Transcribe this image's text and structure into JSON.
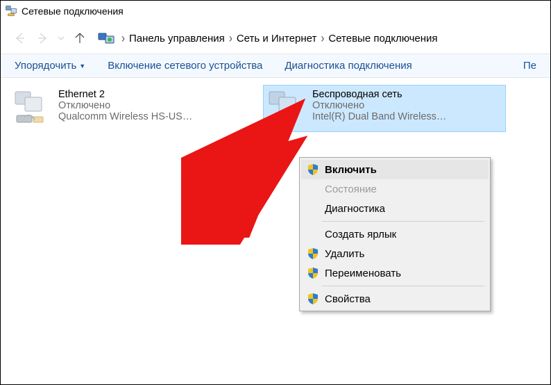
{
  "window": {
    "title": "Сетевые подключения"
  },
  "breadcrumb": {
    "items": [
      "Панель управления",
      "Сеть и Интернет",
      "Сетевые подключения"
    ]
  },
  "toolbar": {
    "organize": "Упорядочить",
    "enable_device": "Включение сетевого устройства",
    "diagnose": "Диагностика подключения",
    "more": "Пе"
  },
  "adapters": [
    {
      "name": "Ethernet 2",
      "status": "Отключено",
      "device": "Qualcomm Wireless HS-US…",
      "selected": false
    },
    {
      "name": "Беспроводная сеть",
      "status": "Отключено",
      "device": "Intel(R) Dual Band Wireless…",
      "selected": true
    }
  ],
  "context_menu": {
    "enable": "Включить",
    "status": "Состояние",
    "diagnose": "Диагностика",
    "shortcut": "Создать ярлык",
    "delete": "Удалить",
    "rename": "Переименовать",
    "properties": "Свойства"
  }
}
